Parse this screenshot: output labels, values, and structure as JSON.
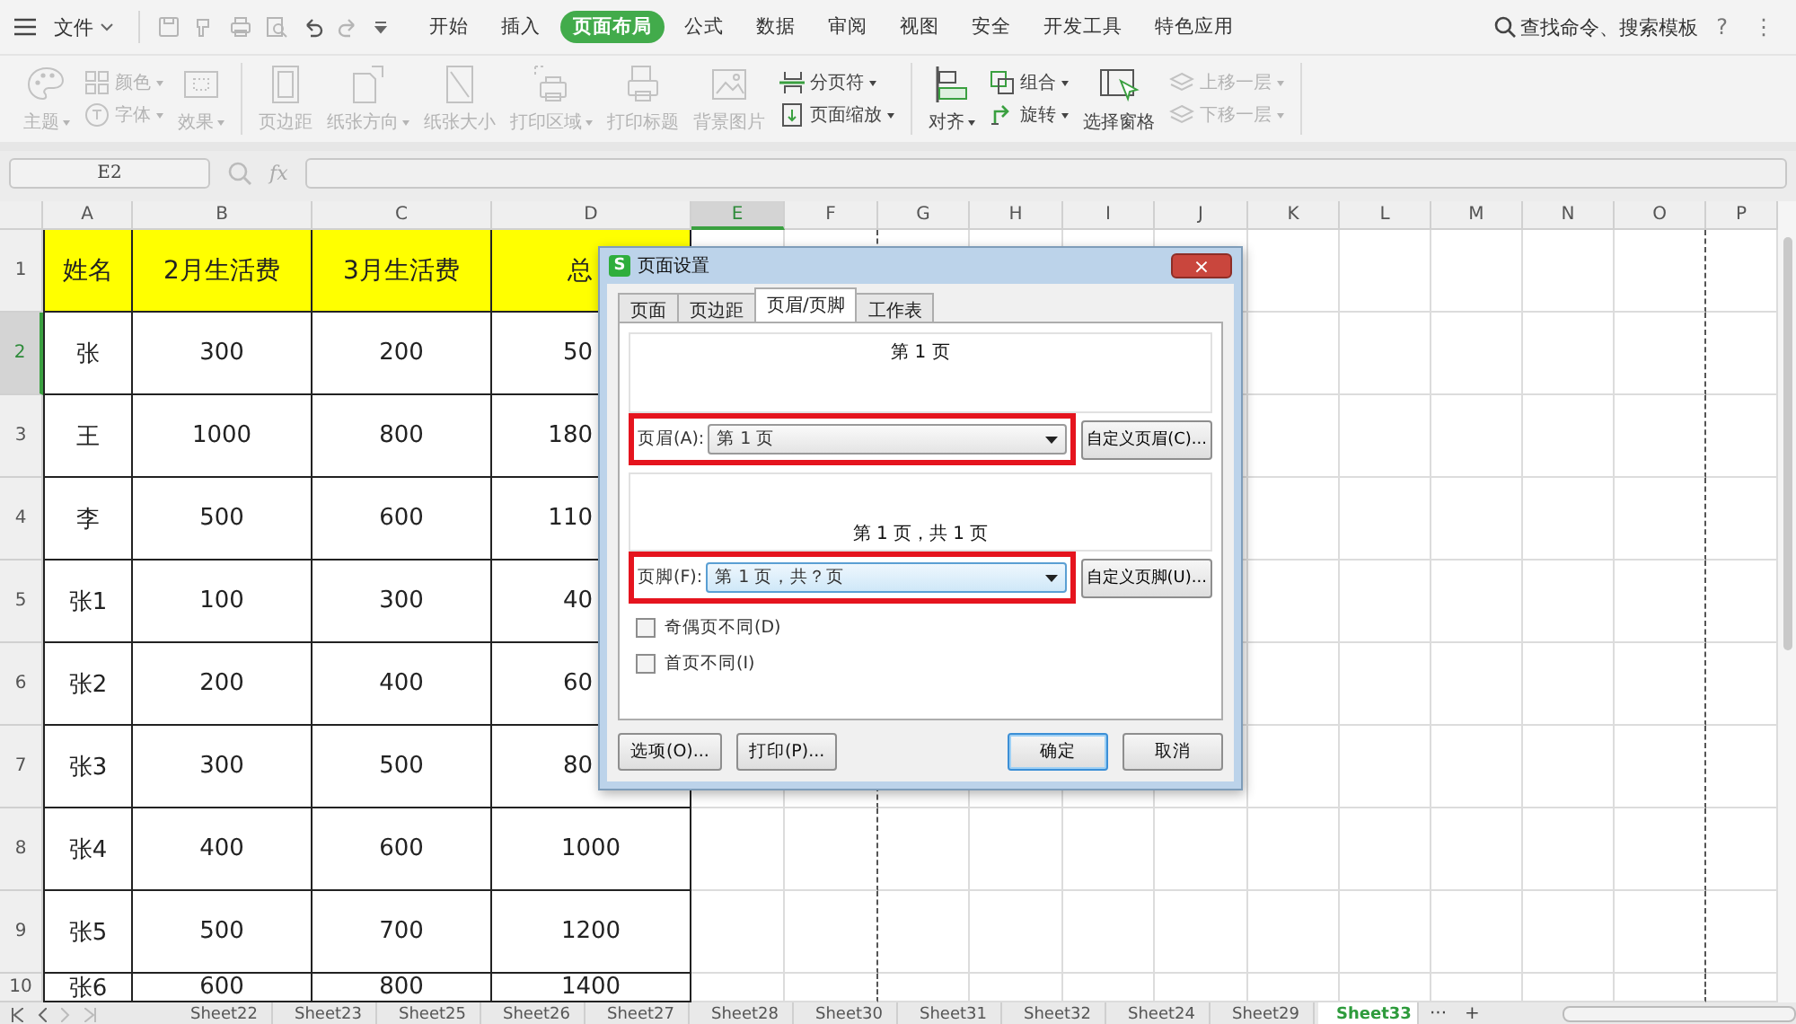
{
  "menu": {
    "file": "文件",
    "tabs": [
      {
        "label": "开始",
        "selected": false
      },
      {
        "label": "插入",
        "selected": false
      },
      {
        "label": "页面布局",
        "selected": true
      },
      {
        "label": "公式",
        "selected": false
      },
      {
        "label": "数据",
        "selected": false
      },
      {
        "label": "审阅",
        "selected": false
      },
      {
        "label": "视图",
        "selected": false
      },
      {
        "label": "安全",
        "selected": false
      },
      {
        "label": "开发工具",
        "selected": false
      },
      {
        "label": "特色应用",
        "selected": false
      }
    ],
    "search": "查找命令、搜索模板",
    "help": "?",
    "more": "⋮"
  },
  "ribbon": {
    "groups": [
      {
        "items": [
          {
            "kind": "big",
            "label": "主题",
            "dropdown": true,
            "disabled": true
          },
          {
            "kind": "stack",
            "items": [
              {
                "label": "颜色",
                "dropdown": true,
                "disabled": true
              },
              {
                "label": "字体",
                "dropdown": true,
                "disabled": true
              }
            ]
          },
          {
            "kind": "big",
            "label": "效果",
            "dropdown": true,
            "disabled": true
          }
        ]
      },
      {
        "items": [
          {
            "kind": "big",
            "label": "页边距",
            "dropdown": false,
            "disabled": true
          },
          {
            "kind": "big",
            "label": "纸张方向",
            "dropdown": true,
            "disabled": true
          },
          {
            "kind": "big",
            "label": "纸张大小",
            "dropdown": false,
            "disabled": true
          },
          {
            "kind": "big",
            "label": "打印区域",
            "dropdown": true,
            "disabled": true
          },
          {
            "kind": "big",
            "label": "打印标题",
            "dropdown": false,
            "disabled": true
          },
          {
            "kind": "big",
            "label": "背景图片",
            "dropdown": false,
            "disabled": true
          },
          {
            "kind": "stack",
            "items": [
              {
                "label": "分页符",
                "dropdown": true,
                "disabled": false
              },
              {
                "label": "页面缩放",
                "dropdown": true,
                "disabled": false
              }
            ]
          }
        ]
      },
      {
        "items": [
          {
            "kind": "big",
            "label": "对齐",
            "dropdown": true,
            "disabled": false
          },
          {
            "kind": "stack",
            "items": [
              {
                "label": "组合",
                "dropdown": true,
                "disabled": false
              },
              {
                "label": "旋转",
                "dropdown": true,
                "disabled": false
              }
            ]
          },
          {
            "kind": "big",
            "label": "选择窗格",
            "dropdown": false,
            "disabled": false
          },
          {
            "kind": "stack",
            "items": [
              {
                "label": "上移一层",
                "dropdown": true,
                "disabled": true
              },
              {
                "label": "下移一层",
                "dropdown": true,
                "disabled": true
              }
            ]
          }
        ]
      }
    ]
  },
  "formula_bar": {
    "name_box": "E2",
    "fx": "fx"
  },
  "sheet": {
    "columns": [
      {
        "label": "A",
        "selected": false,
        "page_break_after": false
      },
      {
        "label": "B",
        "selected": false,
        "page_break_after": false
      },
      {
        "label": "C",
        "selected": false,
        "page_break_after": false
      },
      {
        "label": "D",
        "selected": false,
        "page_break_after": false
      },
      {
        "label": "E",
        "selected": true,
        "page_break_after": false
      },
      {
        "label": "F",
        "selected": false,
        "page_break_after": true
      },
      {
        "label": "G",
        "selected": false,
        "page_break_after": false
      },
      {
        "label": "H",
        "selected": false,
        "page_break_after": false
      },
      {
        "label": "I",
        "selected": false,
        "page_break_after": false
      },
      {
        "label": "J",
        "selected": false,
        "page_break_after": false
      },
      {
        "label": "K",
        "selected": false,
        "page_break_after": false
      },
      {
        "label": "L",
        "selected": false,
        "page_break_after": false
      },
      {
        "label": "M",
        "selected": false,
        "page_break_after": false
      },
      {
        "label": "N",
        "selected": false,
        "page_break_after": false
      },
      {
        "label": "O",
        "selected": false,
        "page_break_after": true
      },
      {
        "label": "P",
        "selected": false,
        "page_break_after": false
      }
    ],
    "rows": [
      {
        "number": "1",
        "kind": "header",
        "selected": false,
        "cells": [
          "姓名",
          "2月生活费",
          "3月生活费",
          "总"
        ]
      },
      {
        "number": "2",
        "kind": "data",
        "selected": true,
        "cells": [
          "张",
          "300",
          "200",
          "50"
        ]
      },
      {
        "number": "3",
        "kind": "data",
        "selected": false,
        "cells": [
          "王",
          "1000",
          "800",
          "180"
        ]
      },
      {
        "number": "4",
        "kind": "data",
        "selected": false,
        "cells": [
          "李",
          "500",
          "600",
          "110"
        ]
      },
      {
        "number": "5",
        "kind": "data",
        "selected": false,
        "cells": [
          "张1",
          "100",
          "300",
          "40"
        ]
      },
      {
        "number": "6",
        "kind": "data",
        "selected": false,
        "cells": [
          "张2",
          "200",
          "400",
          "60"
        ]
      },
      {
        "number": "7",
        "kind": "data",
        "selected": false,
        "cells": [
          "张3",
          "300",
          "500",
          "80"
        ]
      },
      {
        "number": "8",
        "kind": "data",
        "selected": false,
        "cells": [
          "张4",
          "400",
          "600",
          "1000"
        ]
      },
      {
        "number": "9",
        "kind": "data",
        "selected": false,
        "cells": [
          "张5",
          "500",
          "700",
          "1200"
        ]
      },
      {
        "number": "10",
        "kind": "data",
        "selected": false,
        "cells": [
          "张6",
          "600",
          "800",
          "1400"
        ]
      }
    ]
  },
  "sheet_tabs": {
    "tabs": [
      {
        "label": "Sheet22",
        "selected": false
      },
      {
        "label": "Sheet23",
        "selected": false
      },
      {
        "label": "Sheet25",
        "selected": false
      },
      {
        "label": "Sheet26",
        "selected": false
      },
      {
        "label": "Sheet27",
        "selected": false
      },
      {
        "label": "Sheet28",
        "selected": false
      },
      {
        "label": "Sheet30",
        "selected": false
      },
      {
        "label": "Sheet31",
        "selected": false
      },
      {
        "label": "Sheet32",
        "selected": false
      },
      {
        "label": "Sheet24",
        "selected": false
      },
      {
        "label": "Sheet29",
        "selected": false
      },
      {
        "label": "Sheet33",
        "selected": true
      }
    ],
    "more": "···",
    "add": "+"
  },
  "dialog": {
    "app_icon": "S",
    "title": "页面设置",
    "close": "×",
    "tabs": [
      {
        "label": "页面",
        "selected": false
      },
      {
        "label": "页边距",
        "selected": false
      },
      {
        "label": "页眉/页脚",
        "selected": true
      },
      {
        "label": "工作表",
        "selected": false
      }
    ],
    "header_preview": "第 1 页",
    "header": {
      "label": "页眉(A):",
      "value": "第 1 页",
      "focused": false,
      "highlighted": true,
      "button": "自定义页眉(C)..."
    },
    "footer_preview": "第 1 页，共 1 页",
    "footer": {
      "label": "页脚(F):",
      "value": "第 1 页，共？页",
      "focused": true,
      "highlighted": true,
      "button": "自定义页脚(U)..."
    },
    "checkboxes": [
      {
        "label": "奇偶页不同(D)",
        "checked": false
      },
      {
        "label": "首页不同(I)",
        "checked": false
      }
    ],
    "buttons": [
      {
        "label": "选项(O)...",
        "default": false
      },
      {
        "label": "打印(P)...",
        "default": false
      },
      {
        "label": "确定",
        "default": true
      },
      {
        "label": "取消",
        "default": false
      }
    ]
  }
}
